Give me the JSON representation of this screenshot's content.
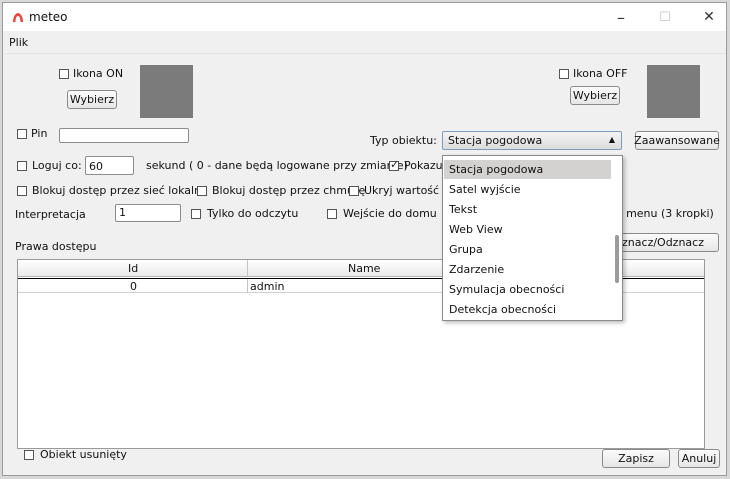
{
  "window": {
    "title": "meteo",
    "minimize": "–",
    "maximize": "☐",
    "close": "✕"
  },
  "menu": {
    "items": [
      "Plik"
    ]
  },
  "icon_on": {
    "label": "Ikona ON",
    "button": "Wybierz",
    "checked": false
  },
  "icon_off": {
    "label": "Ikona OFF",
    "button": "Wybierz",
    "checked": false
  },
  "pin": {
    "label": "Pin",
    "value": "",
    "checked": false
  },
  "object_type": {
    "label": "Typ obiektu:",
    "value": "Stacja pogodowa",
    "advanced_button": "Zaawansowane"
  },
  "log": {
    "label": "Loguj co:",
    "value": "60",
    "suffix": "sekund ( 0 - dane będą logowane przy zmianie)",
    "checked": false
  },
  "show": {
    "label": "Pokazuj",
    "checked": true
  },
  "block_local": {
    "label": "Blokuj dostęp przez sieć lokalną",
    "checked": false
  },
  "block_cloud": {
    "label": "Blokuj dostęp przez chmurę",
    "checked": false
  },
  "hide_value": {
    "label": "Ukryj wartość na",
    "checked": false
  },
  "interpretation": {
    "label": "Interpretacja",
    "value": "1"
  },
  "read_only": {
    "label": "Tylko do odczytu",
    "checked": false
  },
  "home_input": {
    "label": "Wejście do domu",
    "checked": false
  },
  "hide_menu": {
    "label": "yj menu (3 kropki)"
  },
  "access": {
    "label": "Prawa dostępu",
    "toggle_button": "znacz/Odznacz",
    "columns": [
      "Id",
      "Name"
    ],
    "rows": [
      {
        "id": "0",
        "name": "admin"
      }
    ]
  },
  "dropdown": {
    "options": [
      "Stacja pogodowa",
      "Satel wyjście",
      "Tekst",
      "Web View",
      "Grupa",
      "Zdarzenie",
      "Symulacja obecności",
      "Detekcja obecności"
    ],
    "selected": "Stacja pogodowa"
  },
  "deleted": {
    "label": "Obiekt usunięty",
    "checked": false
  },
  "footer": {
    "save": "Zapisz",
    "cancel": "Anuluj"
  },
  "colors": {
    "app_icon": "#e8453c",
    "dropdown_selected": "#d3d2d1",
    "gray_box": "#7b7b7b"
  },
  "icons": {
    "app": "app-logo-icon"
  }
}
